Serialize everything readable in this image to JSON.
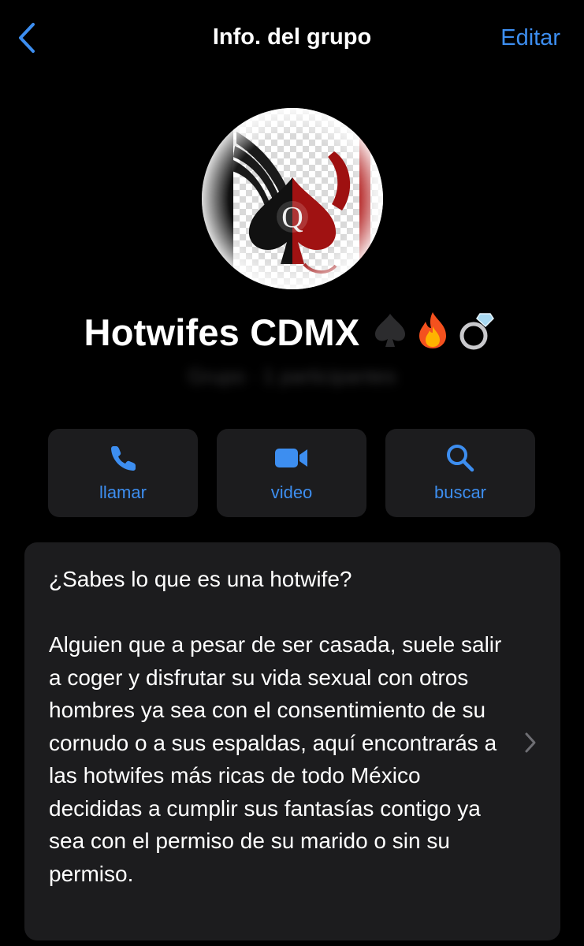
{
  "nav": {
    "back_icon": "chevron-left-icon",
    "title": "Info. del grupo",
    "edit_label": "Editar"
  },
  "group": {
    "avatar_letter": "Q",
    "name": "Hotwifes CDMX",
    "emojis": [
      "spade-icon",
      "fire-icon",
      "ring-icon"
    ],
    "subtitle": "Grupo · 1 participantes"
  },
  "actions": [
    {
      "label": "llamar",
      "icon": "phone-icon"
    },
    {
      "label": "video",
      "icon": "video-camera-icon"
    },
    {
      "label": "buscar",
      "icon": "search-icon"
    }
  ],
  "description": {
    "text": "¿Sabes lo que es una hotwife?\n\nAlguien que a pesar de ser casada, suele salir a coger y disfrutar su vida sexual con otros hombres ya sea con el consentimiento de su cornudo o a sus espaldas, aquí encontrarás a las hotwifes más ricas de todo México decididas a cumplir sus fantasías contigo ya sea con el permiso de su marido o sin su permiso.",
    "chevron_icon": "chevron-right-icon"
  },
  "colors": {
    "background": "#000000",
    "card": "#1c1c1e",
    "accent": "#3d8ef0",
    "text": "#ffffff"
  }
}
